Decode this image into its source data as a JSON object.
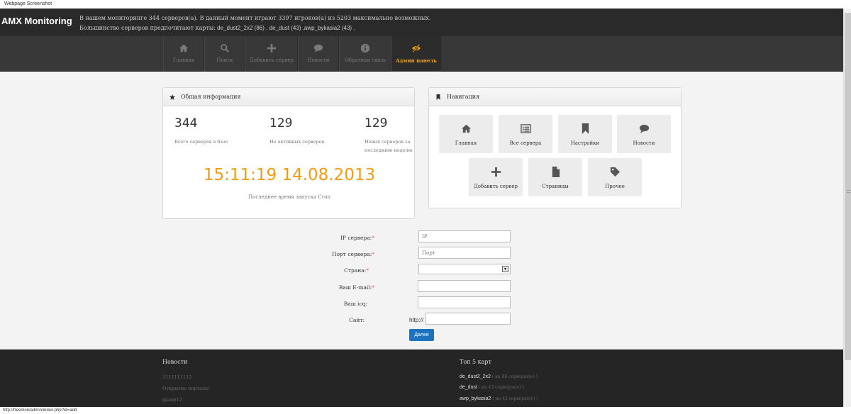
{
  "screenshot_label": "Webpage Screenshot",
  "header": {
    "logo": "AMX Monitoring",
    "line1": "В нашем мониторинге 344 серверов(а). В данный момент играют 3397 игроков(а) из 5203 максимально возможных.",
    "line2_prefix": "Большинство серверов предпочитают карты:",
    "line2_maps": " de_dust2_2x2 (86) , de_dust (43) ,awp_bykasia2 (43) ."
  },
  "nav": {
    "items": [
      {
        "label": "Главная",
        "icon": "home-icon"
      },
      {
        "label": "Поиск",
        "icon": "search-icon"
      },
      {
        "label": "Добавить сервер",
        "icon": "plus-icon"
      },
      {
        "label": "Новости",
        "icon": "comment-icon"
      },
      {
        "label": "Обратная связь",
        "icon": "info-icon"
      },
      {
        "label": "Админ панель",
        "icon": "eye-slash-icon",
        "active": true
      }
    ],
    "active_color": "#f0a10a"
  },
  "info_panel": {
    "title": "Общая информация",
    "stats": [
      {
        "value": "344",
        "label": "Всего серверов в базе"
      },
      {
        "value": "129",
        "label": "Не активных серверов"
      },
      {
        "value": "129",
        "label": "Новых серверов за последнюю неделю"
      }
    ],
    "cron_time": "15:11:19 14.08.2013",
    "cron_label": "Последнее время запуска Cron",
    "accent_color": "#f39c12"
  },
  "nav_panel": {
    "title": "Навигация",
    "tiles": [
      {
        "label": "Главная",
        "icon": "home-icon"
      },
      {
        "label": "Все сервера",
        "icon": "list-icon"
      },
      {
        "label": "Настройки",
        "icon": "bookmark-icon"
      },
      {
        "label": "Новости",
        "icon": "comment-icon"
      },
      {
        "label": "Добавить сервер",
        "icon": "plus-icon"
      },
      {
        "label": "Страницы",
        "icon": "file-icon"
      },
      {
        "label": "Прочее",
        "icon": "tag-icon"
      }
    ]
  },
  "form": {
    "ip_label": "IP сервера:",
    "ip_placeholder": "IP",
    "port_label": "Порт сервера:",
    "port_placeholder": "Порт",
    "country_label": "Страна:",
    "country_value": "",
    "email_label": "Ваш E-mail:",
    "email_value": "",
    "icq_label": "Ваш icq:",
    "icq_value": "",
    "site_label": "Сайт:",
    "site_prefix": "http://",
    "site_value": "",
    "required_mark": "*",
    "submit_label": "Далее",
    "button_color": "#1e73be"
  },
  "footer": {
    "news_title": "Новости",
    "news": [
      "1111111112",
      "Открытие портала!",
      "фыаф12"
    ],
    "maps_title": "Топ 5 карт",
    "maps": [
      {
        "name": "de_dust2_2x2",
        "count": " ( на 86 серверах(е) )"
      },
      {
        "name": "de_dust",
        "count": " ( на 43 серверах(е) )"
      },
      {
        "name": "awp_bykasia2",
        "count": " ( на 43 серверах(е) )"
      }
    ]
  },
  "status_url": "http://freemon/admin/index.php?id=add"
}
